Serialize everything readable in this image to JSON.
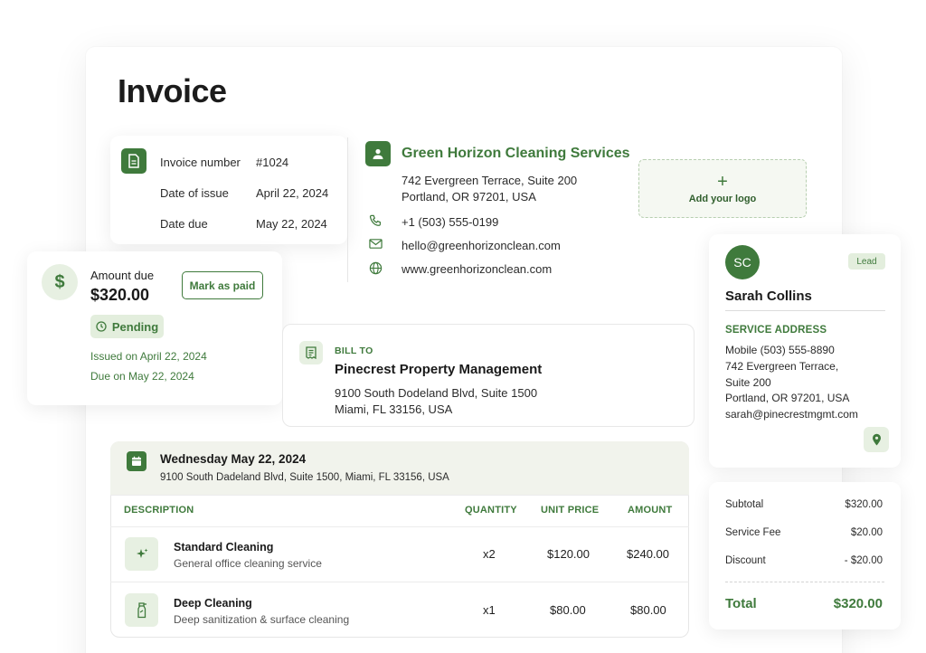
{
  "page": {
    "title": "Invoice"
  },
  "invoice_meta": {
    "rows": [
      {
        "label": "Invoice number",
        "value": "#1024"
      },
      {
        "label": "Date of issue",
        "value": "April 22, 2024"
      },
      {
        "label": "Date due",
        "value": "May 22, 2024"
      }
    ]
  },
  "company": {
    "name": "Green Horizon Cleaning Services",
    "address_line1": "742 Evergreen Terrace, Suite 200",
    "address_line2": "Portland, OR 97201, USA",
    "phone": "+1 (503) 555-0199",
    "email": "hello@greenhorizonclean.com",
    "website": "www.greenhorizonclean.com"
  },
  "logo": {
    "plus": "+",
    "label": "Add your logo"
  },
  "amount": {
    "label": "Amount due",
    "value": "$320.00",
    "status": "Pending",
    "issued": "Issued on April 22, 2024",
    "due": "Due on May 22, 2024",
    "mark_paid": "Mark as paid",
    "dollar": "$"
  },
  "bill_to": {
    "heading": "BILL TO",
    "name": "Pinecrest Property Management",
    "address_line1": "9100 South Dodeland Blvd, Suite 1500",
    "address_line2": "Miami, FL 33156, USA"
  },
  "client": {
    "initials": "SC",
    "badge": "Lead",
    "name": "Sarah Collins",
    "section": "SERVICE ADDRESS",
    "lines": [
      "Mobile (503) 555-8890",
      "742 Evergreen Terrace,",
      "Suite 200",
      "Portland, OR 97201, USA",
      "sarah@pinecrestmgmt.com"
    ]
  },
  "totals": {
    "rows": [
      {
        "label": "Subtotal",
        "value": "$320.00"
      },
      {
        "label": "Service Fee",
        "value": "$20.00"
      },
      {
        "label": "Discount",
        "value": "- $20.00"
      }
    ],
    "total_label": "Total",
    "total_value": "$320.00"
  },
  "job": {
    "date": "Wednesday May 22, 2024",
    "address": "9100 South Dadeland Blvd, Suite 1500, Miami, FL 33156, USA",
    "columns": [
      "DESCRIPTION",
      "QUANTITY",
      "UNIT PRICE",
      "AMOUNT"
    ],
    "items": [
      {
        "name": "Standard Cleaning",
        "desc": "General office cleaning service",
        "qty": "x2",
        "unit": "$120.00",
        "amount": "$240.00",
        "icon": "sparkle-icon"
      },
      {
        "name": "Deep Cleaning",
        "desc": "Deep sanitization & surface cleaning",
        "qty": "x1",
        "unit": "$80.00",
        "amount": "$80.00",
        "icon": "spray-bottle-icon"
      }
    ]
  },
  "colors": {
    "accent": "#3f7a3c",
    "accent_light": "#e3eedd"
  }
}
